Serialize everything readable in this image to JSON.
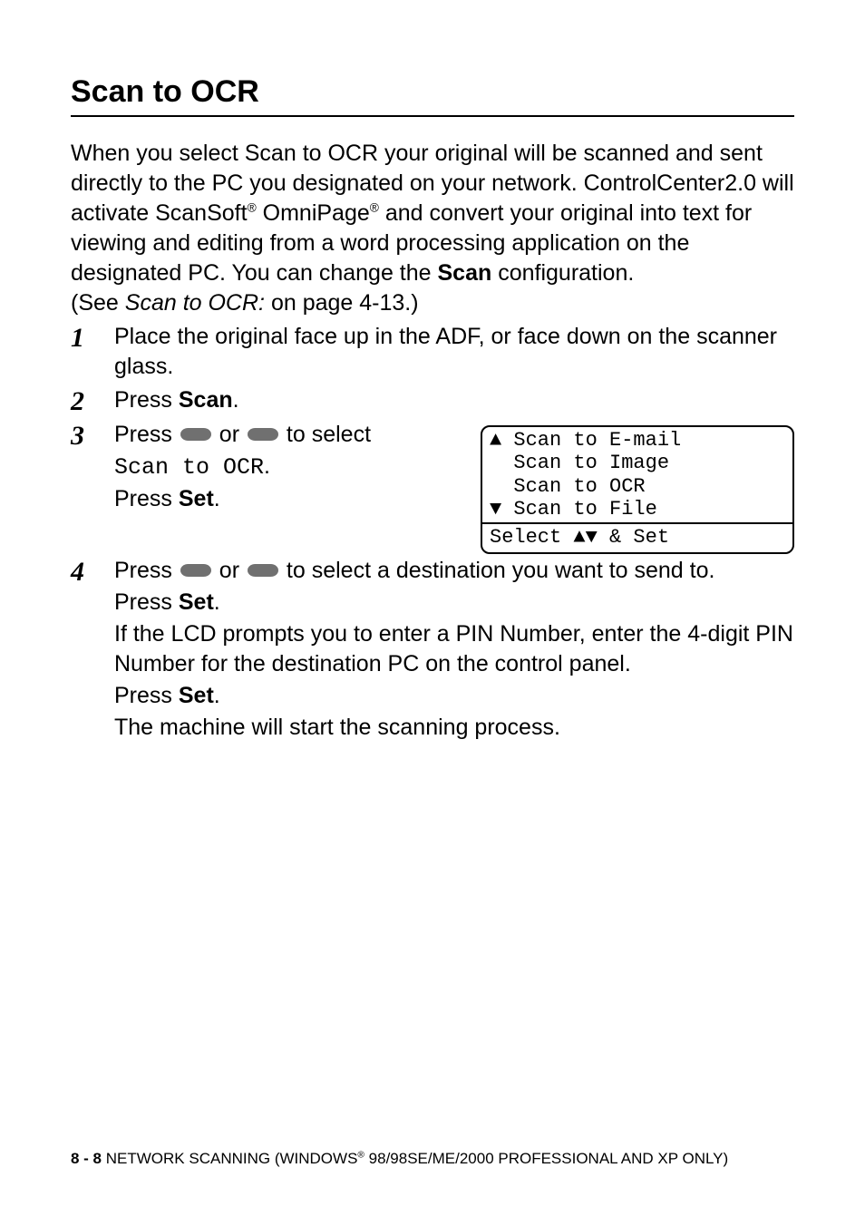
{
  "heading": "Scan to OCR",
  "intro": {
    "p1a": "When you select Scan to OCR your original will be scanned and sent directly to the PC you designated on your network. ControlCenter2.0 will activate ScanSoft",
    "p1b": " OmniPage",
    "p1c": " and convert your original into text for viewing and editing from a word processing application on the designated PC. You can change the ",
    "scan_bold": "Scan",
    "p1d": " configuration.",
    "see_a": "(See ",
    "see_italic": "Scan to OCR:",
    "see_b": " on page 4-13.)"
  },
  "step1": {
    "num": "1",
    "text": "Place the original face up in the ADF, or face down on the scanner glass."
  },
  "step2": {
    "num": "2",
    "press": "Press ",
    "scan": "Scan",
    "dot": "."
  },
  "step3": {
    "num": "3",
    "press": "Press ",
    "or": " or ",
    "to_select": " to select",
    "mono": "Scan to OCR",
    "dot": ".",
    "press2": "Press ",
    "set": "Set",
    "dot2": "."
  },
  "step4": {
    "num": "4",
    "press": "Press ",
    "or": " or ",
    "to_select_a": " to select a destination you want to send to.",
    "press2": "Press ",
    "set": "Set",
    "dot2": ".",
    "pin": "If the LCD prompts you to enter a PIN Number, enter the 4-digit PIN Number for the destination PC on the control panel.",
    "press3": "Press ",
    "set3": "Set",
    "dot3": ".",
    "final": "The machine will start the scanning process."
  },
  "lcd": {
    "r1": "▲ Scan to E-mail",
    "r2": "  Scan to Image",
    "r3": "  Scan to OCR",
    "r4": "▼ Scan to File",
    "r5": "Select ▲▼ & Set"
  },
  "footer": {
    "page": "8 - 8",
    "title_a": "   NETWORK SCANNING (WINDOWS",
    "title_b": " 98/98SE/ME/2000 PROFESSIONAL AND XP ONLY)"
  }
}
